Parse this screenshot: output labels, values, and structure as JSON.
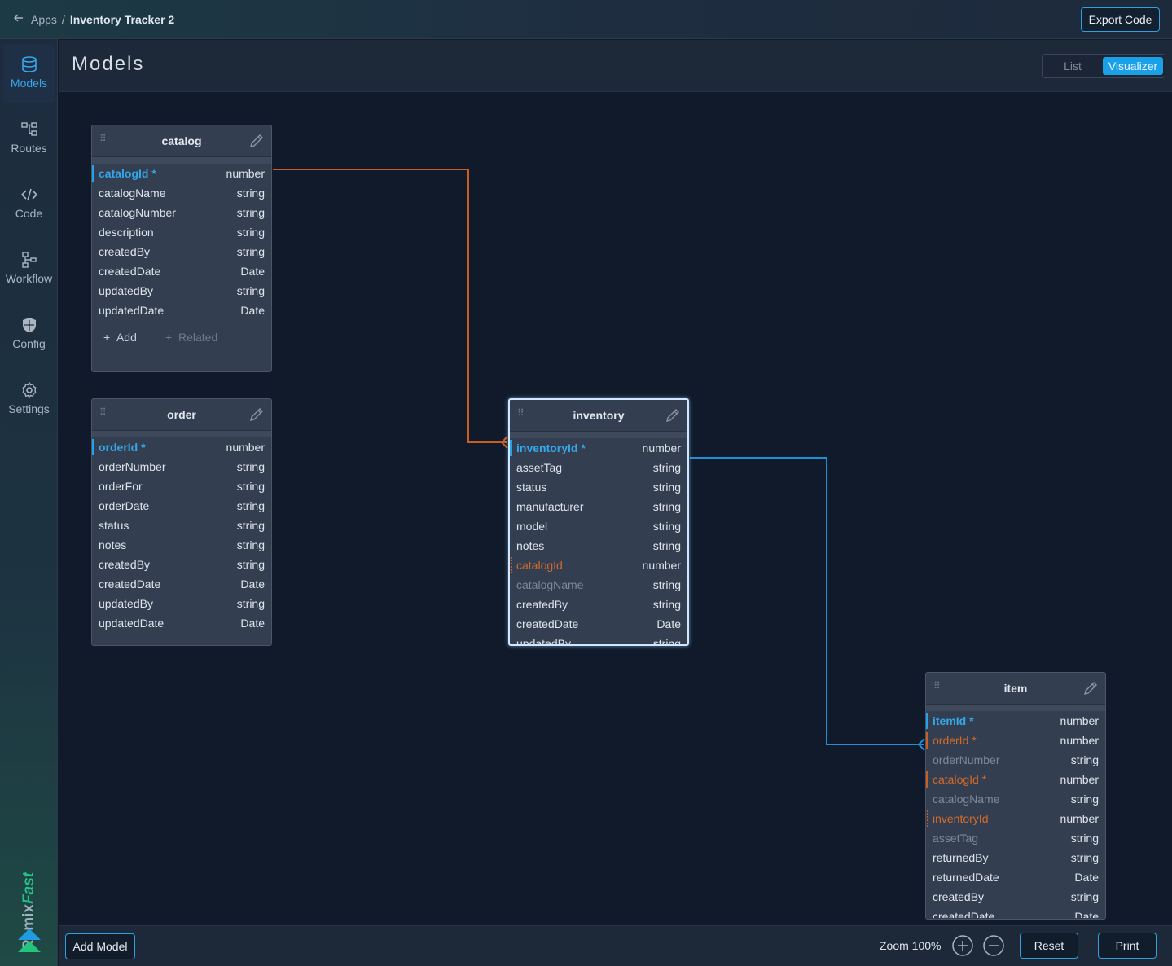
{
  "topbar": {
    "back_icon": "arrow-left-icon",
    "apps": "Apps",
    "sep": "/",
    "project": "Inventory Tracker 2",
    "export": "Export Code"
  },
  "sidebar": {
    "items": [
      {
        "label": "Models",
        "icon": "database-icon",
        "active": true
      },
      {
        "label": "Routes",
        "icon": "routes-icon"
      },
      {
        "label": "Code",
        "icon": "code-icon"
      },
      {
        "label": "Workflow",
        "icon": "workflow-icon"
      },
      {
        "label": "Config",
        "icon": "shield-icon"
      },
      {
        "label": "Settings",
        "icon": "gear-icon"
      }
    ],
    "brand_a": "Remix",
    "brand_b": "Fast"
  },
  "header": {
    "title": "Models",
    "view_list": "List",
    "view_visualizer": "Visualizer"
  },
  "models": {
    "catalog": {
      "name": "catalog",
      "fields": [
        {
          "name": "catalogId *",
          "type": "number"
        },
        {
          "name": "catalogName",
          "type": "string"
        },
        {
          "name": "catalogNumber",
          "type": "string"
        },
        {
          "name": "description",
          "type": "string"
        },
        {
          "name": "createdBy",
          "type": "string"
        },
        {
          "name": "createdDate",
          "type": "Date"
        },
        {
          "name": "updatedBy",
          "type": "string"
        },
        {
          "name": "updatedDate",
          "type": "Date"
        }
      ],
      "add": "Add",
      "related": "Related"
    },
    "order": {
      "name": "order",
      "fields": [
        {
          "name": "orderId *",
          "type": "number"
        },
        {
          "name": "orderNumber",
          "type": "string"
        },
        {
          "name": "orderFor",
          "type": "string"
        },
        {
          "name": "orderDate",
          "type": "string"
        },
        {
          "name": "status",
          "type": "string"
        },
        {
          "name": "notes",
          "type": "string"
        },
        {
          "name": "createdBy",
          "type": "string"
        },
        {
          "name": "createdDate",
          "type": "Date"
        },
        {
          "name": "updatedBy",
          "type": "string"
        },
        {
          "name": "updatedDate",
          "type": "Date"
        }
      ]
    },
    "inventory": {
      "name": "inventory",
      "fields": [
        {
          "name": "inventoryId *",
          "type": "number"
        },
        {
          "name": "assetTag",
          "type": "string"
        },
        {
          "name": "status",
          "type": "string"
        },
        {
          "name": "manufacturer",
          "type": "string"
        },
        {
          "name": "model",
          "type": "string"
        },
        {
          "name": "notes",
          "type": "string"
        },
        {
          "name": "catalogId",
          "type": "number"
        },
        {
          "name": "catalogName",
          "type": "string"
        },
        {
          "name": "createdBy",
          "type": "string"
        },
        {
          "name": "createdDate",
          "type": "Date"
        },
        {
          "name": "updatedBy",
          "type": "string"
        }
      ]
    },
    "item": {
      "name": "item",
      "fields": [
        {
          "name": "itemId *",
          "type": "number"
        },
        {
          "name": "orderId *",
          "type": "number"
        },
        {
          "name": "orderNumber",
          "type": "string"
        },
        {
          "name": "catalogId *",
          "type": "number"
        },
        {
          "name": "catalogName",
          "type": "string"
        },
        {
          "name": "inventoryId",
          "type": "number"
        },
        {
          "name": "assetTag",
          "type": "string"
        },
        {
          "name": "returnedBy",
          "type": "string"
        },
        {
          "name": "returnedDate",
          "type": "Date"
        },
        {
          "name": "createdBy",
          "type": "string"
        },
        {
          "name": "createdDate",
          "type": "Date"
        }
      ]
    }
  },
  "footer": {
    "add_model": "Add Model",
    "zoom": "Zoom 100%",
    "reset": "Reset",
    "print": "Print"
  },
  "colors": {
    "accent": "#1aa0e6",
    "foreign_key": "#c95d22",
    "primary_key": "#35a6e8"
  }
}
